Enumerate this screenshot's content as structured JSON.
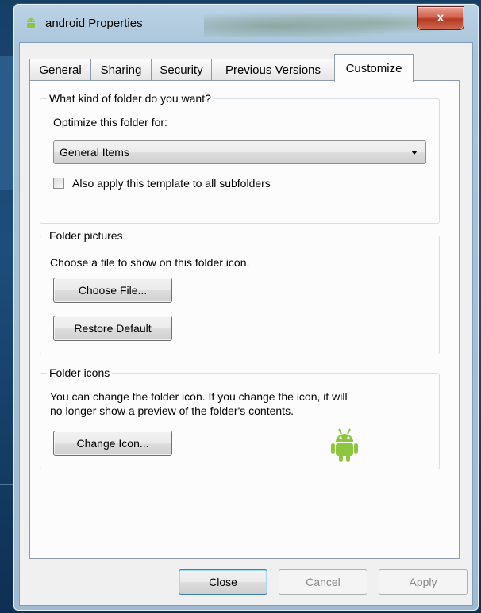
{
  "window": {
    "title": "android Properties",
    "close_glyph": "x"
  },
  "tabs": [
    {
      "label": "General"
    },
    {
      "label": "Sharing"
    },
    {
      "label": "Security"
    },
    {
      "label": "Previous Versions"
    },
    {
      "label": "Customize",
      "active": true
    }
  ],
  "folder_type": {
    "group_title": "What kind of folder do you want?",
    "optimize_label": "Optimize this folder for:",
    "selected_value": "General Items",
    "apply_subfolders_label": "Also apply this template to all subfolders",
    "apply_subfolders_checked": false
  },
  "folder_pictures": {
    "group_title": "Folder pictures",
    "description": "Choose a file to show on this folder icon.",
    "choose_file_label": "Choose File...",
    "restore_default_label": "Restore Default"
  },
  "folder_icons": {
    "group_title": "Folder icons",
    "description_line1": "You can change the folder icon. If you change the icon, it will",
    "description_line2": "no longer show a preview of the folder's contents.",
    "change_icon_label": "Change Icon...",
    "preview_icon": "android-icon"
  },
  "footer": {
    "close_label": "Close",
    "cancel_label": "Cancel",
    "apply_label": "Apply"
  },
  "colors": {
    "android_green": "#8cc63e",
    "close_button_red": "#c8452d",
    "desktop_blue": "#163f66"
  }
}
